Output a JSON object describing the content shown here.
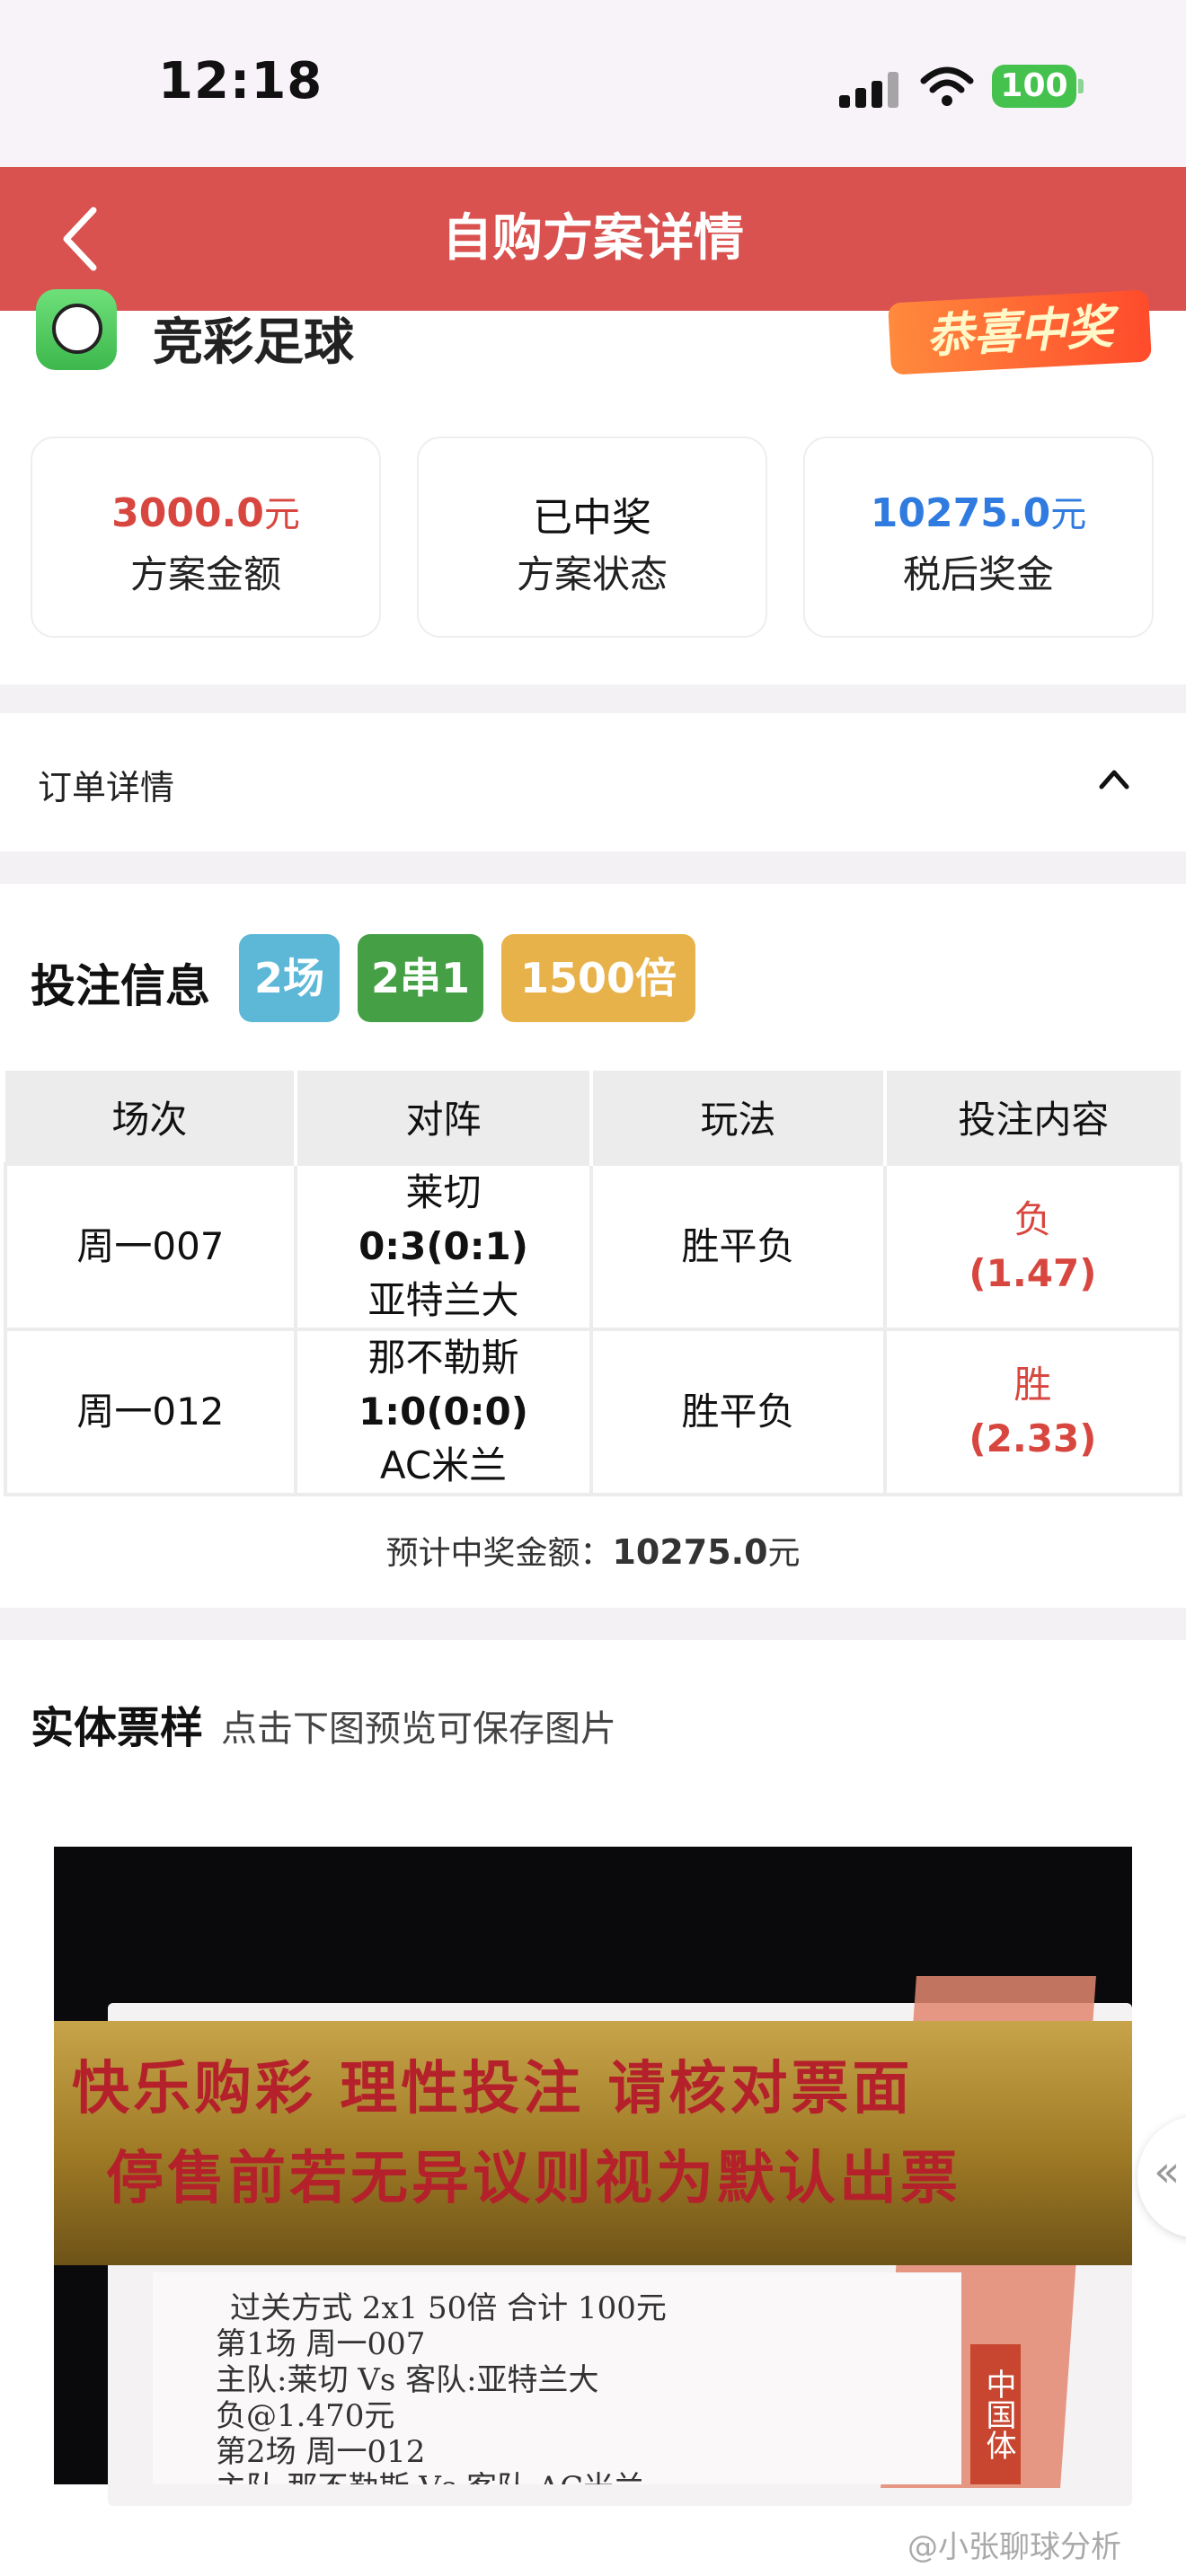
{
  "status_bar": {
    "time": "12:18",
    "battery": "100"
  },
  "nav": {
    "title": "自购方案详情"
  },
  "header": {
    "app_name": "竞彩足球",
    "badge": "恭喜中奖"
  },
  "stats": [
    {
      "value": "3000.0",
      "unit": "元",
      "label": "方案金额",
      "color": "#d8473f"
    },
    {
      "value": "已中奖",
      "unit": "",
      "label": "方案状态",
      "color": "#111111"
    },
    {
      "value": "10275.0",
      "unit": "元",
      "label": "税后奖金",
      "color": "#2f7be0"
    }
  ],
  "order": {
    "label": "订单详情"
  },
  "bet_info": {
    "title": "投注信息",
    "tags": [
      {
        "text": "2场",
        "color": "#5db8d8"
      },
      {
        "text": "2串1",
        "color": "#45a045"
      },
      {
        "text": "1500倍",
        "color": "#e8b24b"
      }
    ],
    "columns": [
      "场次",
      "对阵",
      "玩法",
      "投注内容"
    ],
    "rows": [
      {
        "match_no": "周一007",
        "home": "莱切",
        "score": "0:3(0:1)",
        "away": "亚特兰大",
        "play": "胜平负",
        "pick": "负",
        "odds": "(1.47)"
      },
      {
        "match_no": "周一012",
        "home": "那不勒斯",
        "score": "1:0(0:0)",
        "away": "AC米兰",
        "play": "胜平负",
        "pick": "胜",
        "odds": "(2.33)"
      }
    ],
    "payout_label": "预计中奖金额：",
    "payout_value": "10275.0",
    "payout_unit": "元"
  },
  "ticket": {
    "title": "实体票样",
    "hint": "点击下图预览可保存图片",
    "brass_line1": "快乐购彩  理性投注  请核对票面",
    "brass_line2": "停售前若无异议则视为默认出票",
    "slip_lines": [
      "过关方式 2x1        50倍         合计  100元",
      "第1场   周一007",
      "主队:莱切 Vs 客队:亚特兰大",
      "负@1.470元",
      "第2场   周一012",
      "主队:那不勒斯 Vs 客队:AC米兰"
    ],
    "side_stamp": "中国体"
  },
  "float_button": "«",
  "watermark": "@小张聊球分析"
}
